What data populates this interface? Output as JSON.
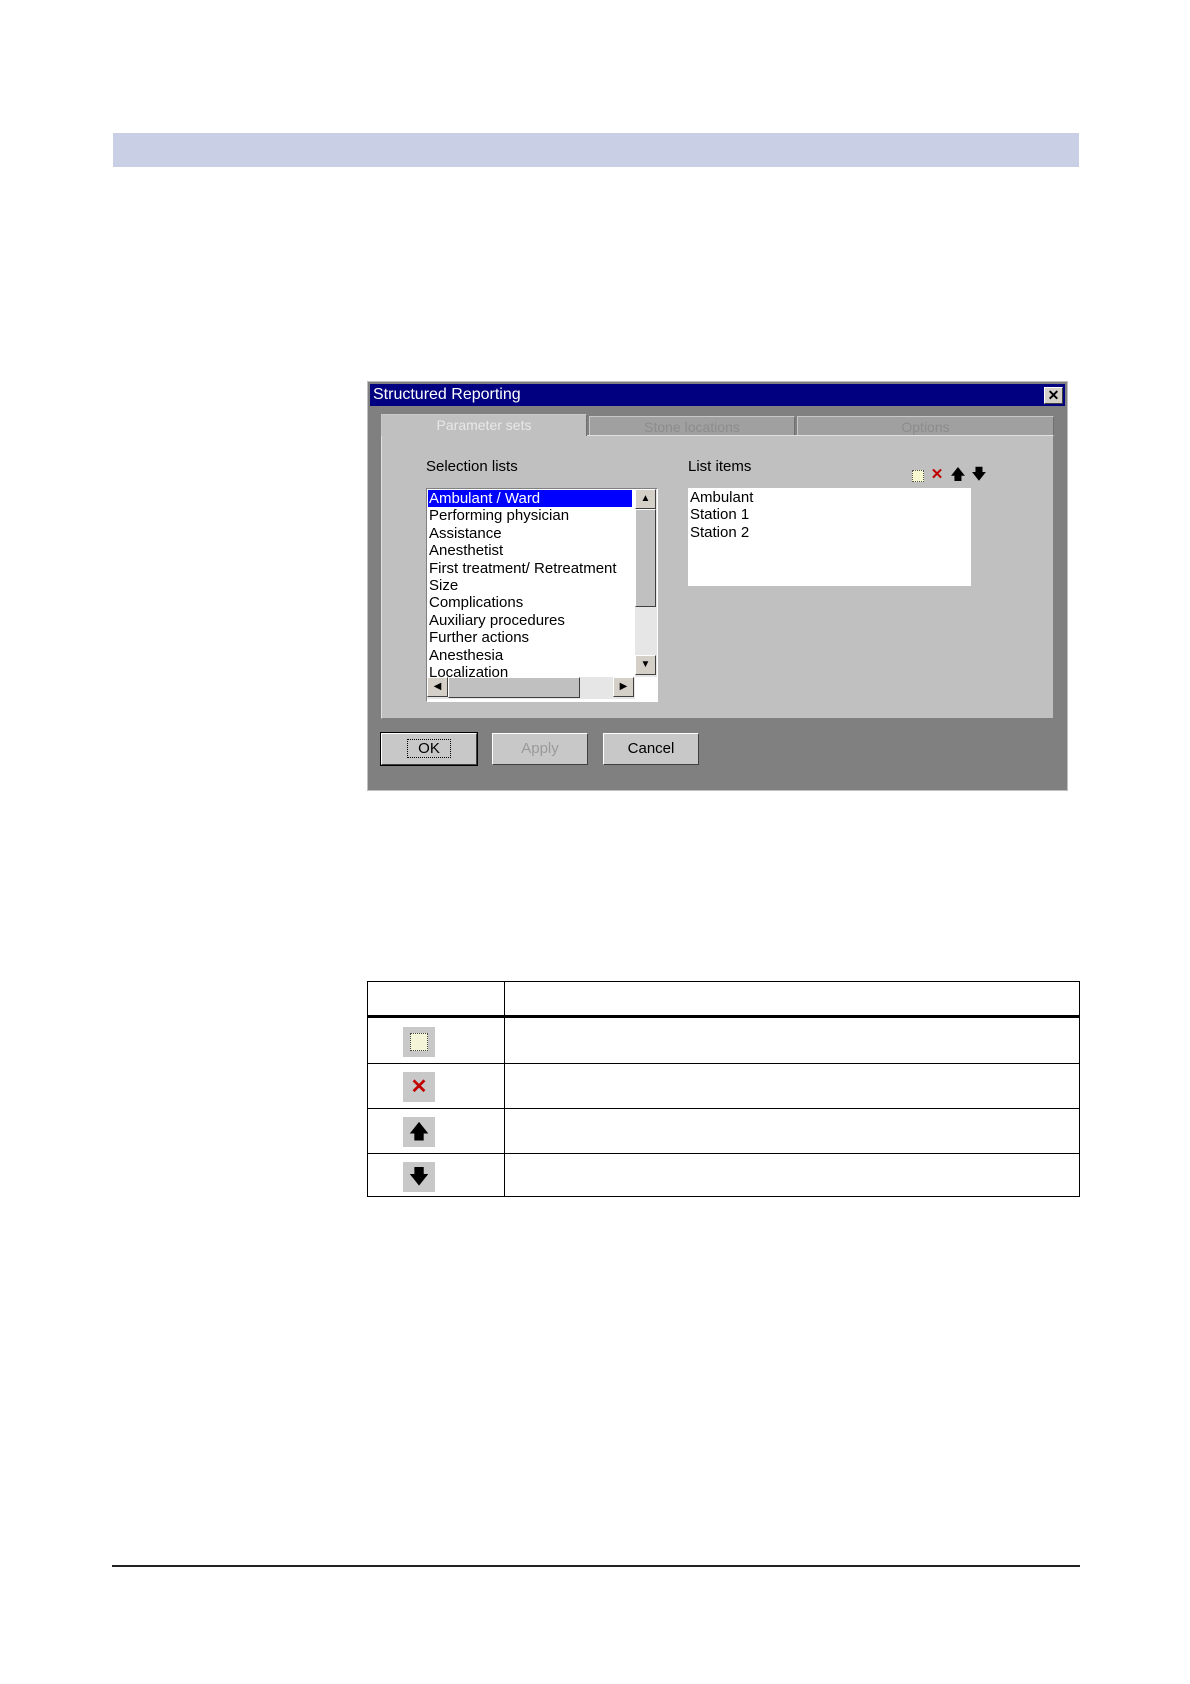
{
  "dialog": {
    "title": "Structured Reporting",
    "close_symbol": "✕",
    "tabs": [
      {
        "label": "Parameter sets",
        "active": true
      },
      {
        "label": "Stone locations",
        "active": false
      },
      {
        "label": "Options",
        "active": false
      }
    ],
    "selection_lists_label": "Selection lists",
    "list_items_label": "List items",
    "selection_lists": [
      "Ambulant / Ward",
      "Performing physician",
      "Assistance",
      "Anesthetist",
      "First treatment/ Retreatment",
      "Size",
      "Complications",
      "Auxiliary procedures",
      "Further actions",
      "Anesthesia",
      "Localization"
    ],
    "list_items": [
      "Ambulant",
      "Station 1",
      "Station 2"
    ],
    "toolbar_icons": [
      "new-item-icon",
      "delete-icon",
      "move-up-icon",
      "move-down-icon"
    ],
    "buttons": {
      "ok": "OK",
      "apply": "Apply",
      "cancel": "Cancel"
    }
  },
  "icon_table": {
    "rows": [
      {
        "icon": "new-item-icon",
        "glyph": "⬚"
      },
      {
        "icon": "delete-icon",
        "glyph": "✕"
      },
      {
        "icon": "move-up-icon",
        "glyph": "🡅"
      },
      {
        "icon": "move-down-icon",
        "glyph": "🡇"
      }
    ]
  },
  "colors": {
    "header_band": "#c9cfe4",
    "title_bar": "#000080",
    "selection": "#0000ff",
    "delete_red": "#c00000"
  }
}
